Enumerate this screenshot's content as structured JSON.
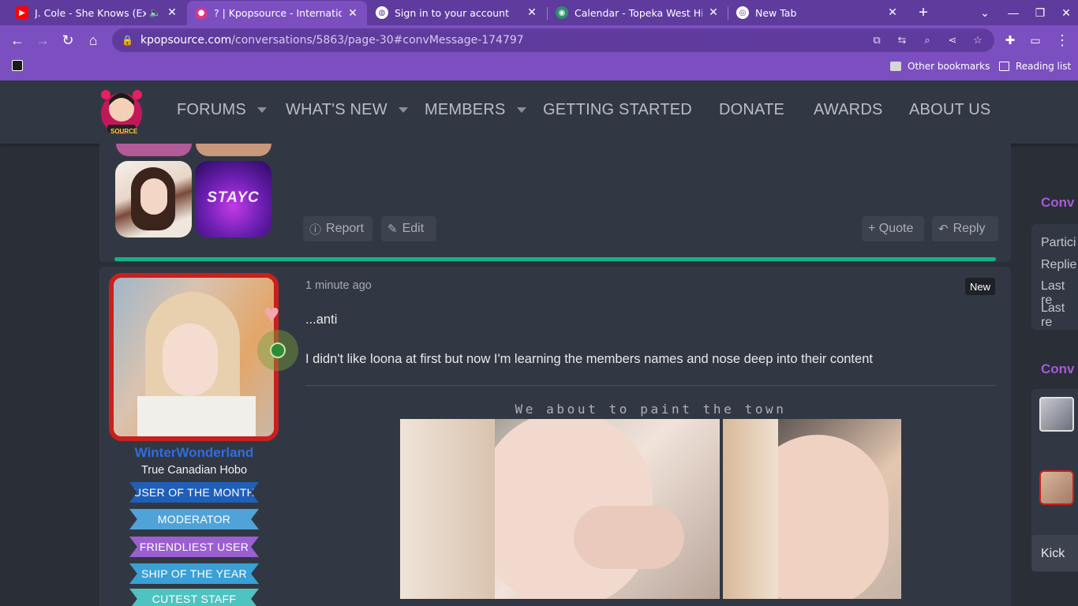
{
  "browser": {
    "tabs": [
      {
        "title": "J. Cole - She Knows (Explicit)",
        "icon": "youtube-icon",
        "audio": true
      },
      {
        "title": "? | Kpopsource - International",
        "icon": "kpopsource-icon",
        "active": true
      },
      {
        "title": "Sign in to your account",
        "icon": "globe-icon"
      },
      {
        "title": "Calendar - Topeka West High S",
        "icon": "calendar-icon"
      },
      {
        "title": "New Tab",
        "icon": "chrome-icon"
      }
    ],
    "url_host": "kpopsource.com",
    "url_path": "/conversations/5863/page-30#convMessage-174797",
    "bookmarks": {
      "other": "Other bookmarks",
      "reading_list": "Reading list"
    }
  },
  "site": {
    "nav": [
      {
        "label": "FORUMS",
        "dropdown": true
      },
      {
        "label": "WHAT'S NEW",
        "dropdown": true
      },
      {
        "label": "MEMBERS",
        "dropdown": true
      },
      {
        "label": "GETTING STARTED",
        "dropdown": false
      },
      {
        "label": "DONATE",
        "dropdown": false
      },
      {
        "label": "AWARDS",
        "dropdown": false
      },
      {
        "label": "ABOUT US",
        "dropdown": false
      }
    ],
    "logo_text": "SOURCE"
  },
  "prev_post": {
    "thumb_text": "STAYC",
    "actions": {
      "report": "Report",
      "edit": "Edit",
      "quote": "+ Quote",
      "reply": "Reply"
    }
  },
  "post": {
    "username": "WinterWonderland",
    "user_title": "True Canadian Hobo",
    "banners": [
      {
        "label": "USER OF THE MONTH",
        "color": "#1f5fb8"
      },
      {
        "label": "MODERATOR",
        "color": "#4fa3d9"
      },
      {
        "label": "FRIENDLIEST USER",
        "color": "#9b5fd1"
      },
      {
        "label": "SHIP OF THE YEAR",
        "color": "#3aa0d6"
      },
      {
        "label": "CUTEST STAFF",
        "color": "#4ec3c0"
      }
    ],
    "time": "1 minute ago",
    "badge": "New",
    "line1": "...anti",
    "line2": "I didn't like loona at first but now I'm learning the members names and nose deep into their content",
    "gif_caption": "We about to paint the town"
  },
  "sidebar": {
    "heading1": "Conv",
    "rows": [
      "Partici",
      "Replie",
      "Last re",
      "Last re"
    ],
    "heading2": "Conv",
    "kick": "Kick"
  },
  "colors": {
    "accent_green": "#14b28a",
    "browser_purple": "#7b4fc0",
    "sidebar_heading": "#a55bd6"
  }
}
